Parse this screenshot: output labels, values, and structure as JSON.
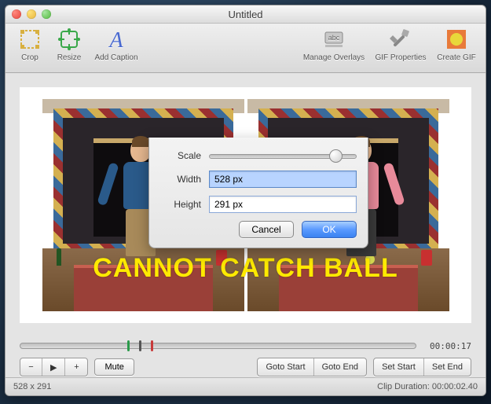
{
  "window": {
    "title": "Untitled"
  },
  "toolbar": {
    "crop": "Crop",
    "resize": "Resize",
    "add_caption": "Add Caption",
    "manage_overlays": "Manage Overlays",
    "gif_properties": "GIF Properties",
    "create_gif": "Create GIF"
  },
  "dialog": {
    "scale_label": "Scale",
    "width_label": "Width",
    "width_value": "528 px",
    "height_label": "Height",
    "height_value": "291 px",
    "cancel": "Cancel",
    "ok": "OK"
  },
  "caption_text": "CANNOT CATCH BALL",
  "timeline": {
    "timecode": "00:00:17"
  },
  "controls": {
    "minus": "−",
    "play": "▶",
    "plus": "+",
    "mute": "Mute",
    "goto_start": "Goto Start",
    "goto_end": "Goto End",
    "set_start": "Set Start",
    "set_end": "Set End"
  },
  "status": {
    "dimensions": "528 x 291",
    "clip_duration_label": "Clip Duration:",
    "clip_duration_value": "00:00:02.40"
  }
}
